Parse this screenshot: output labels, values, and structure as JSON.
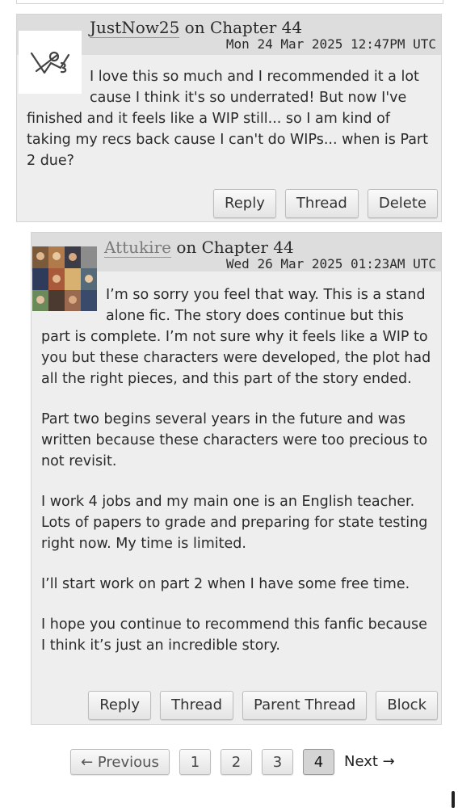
{
  "comments": [
    {
      "username": "JustNow25",
      "on_text": "on Chapter 44",
      "datetime": "Mon 24 Mar 2025 12:47PM UTC",
      "avatar_icon": "default-avatar-icon",
      "paragraphs": [
        "I love this so much and I recommended it a lot cause I think it's so underrated! But now I've finished and it feels like a WIP still... so I am kind of taking my recs back cause I can't do WIPs... when is Part 2 due?"
      ],
      "actions": [
        "Reply",
        "Thread",
        "Delete"
      ]
    },
    {
      "username": "Attukire",
      "on_text": "on Chapter 44",
      "datetime": "Wed 26 Mar 2025 01:23AM UTC",
      "avatar_icon": "user-photo-collage",
      "paragraphs": [
        "I’m so sorry you feel that way. This is a stand alone fic. The story does continue but this part is complete. I’m not sure why it feels like a WIP to you but these characters were developed, the plot had all the right pieces, and this part of the story ended.",
        "Part two begins several years in the future and was written because these characters were too precious to not revisit.",
        "I work 4 jobs and my main one is an English teacher. Lots of papers to grade and preparing for state testing right now. My time is limited.",
        "I’ll start work on part 2 when I have some free time.",
        "I hope you continue to recommend this fanfic because I think it’s just an incredible story."
      ],
      "actions": [
        "Reply",
        "Thread",
        "Parent Thread",
        "Block"
      ]
    }
  ],
  "pagination": {
    "previous": "← Previous",
    "pages": [
      "1",
      "2",
      "3",
      "4"
    ],
    "current": "4",
    "next": "Next →"
  },
  "colors": {
    "comment_bg": "#eeeeee",
    "header_bg": "#dddddd",
    "border": "#d4d4d4"
  }
}
